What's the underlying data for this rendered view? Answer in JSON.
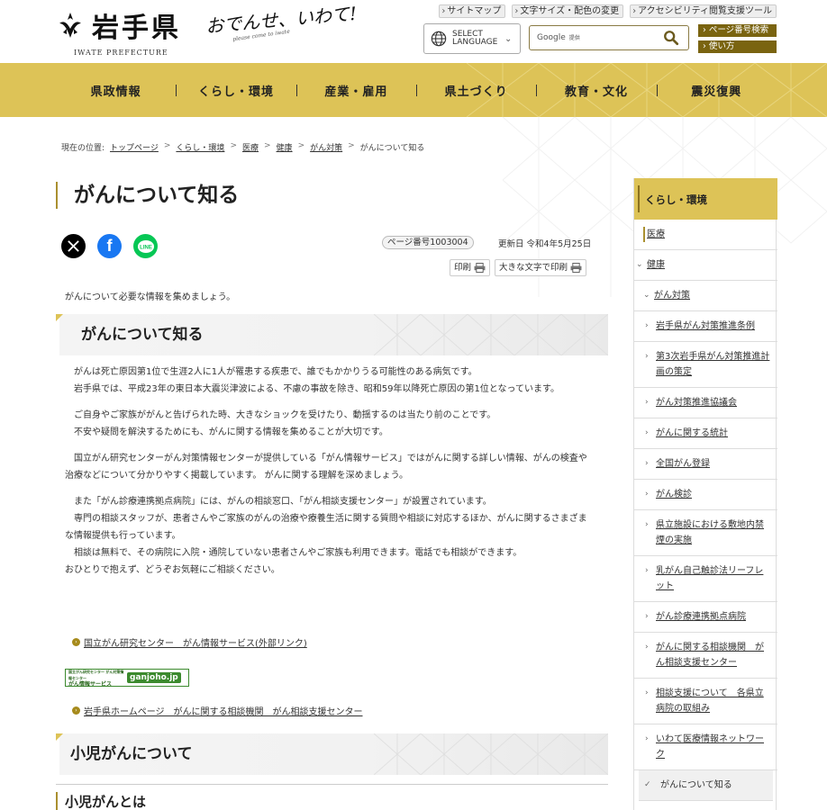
{
  "header": {
    "logo_title": "岩手県",
    "logo_sub": "IWATE PREFECTURE",
    "tagline": "おでんせ、いわて!",
    "tagline_sub": "please come to iwate",
    "util_links": [
      "サイトマップ",
      "文字サイズ・配色の変更",
      "アクセシビリティ閲覧支援ツール"
    ],
    "language_label_1": "SELECT",
    "language_label_2": "LANGUAGE",
    "search_brand": "Google",
    "search_brand_sub": "提供",
    "page_number_search": "ページ番号検索",
    "howto": "使い方"
  },
  "nav": {
    "items": [
      "県政情報",
      "くらし・環境",
      "産業・雇用",
      "県土づくり",
      "教育・文化",
      "震災復興"
    ]
  },
  "breadcrumb": {
    "label": "現在の位置:",
    "items": [
      "トップページ",
      "くらし・環境",
      "医療",
      "健康",
      "がん対策"
    ],
    "current": "がんについて知る"
  },
  "main": {
    "title": "がんについて知る",
    "page_number": "ページ番号1003004",
    "updated": "更新日 令和4年5月25日",
    "print_label": "印刷",
    "print_large_label": "大きな文字で印刷",
    "lead": "がんについて必要な情報を集めましょう。",
    "section1_title": "がんについて知る",
    "paragraphs": [
      "　がんは死亡原因第1位で生涯2人に1人が罹患する疾患で、誰でもかかりうる可能性のある病気です。\n　岩手県では、平成23年の東日本大震災津波による、不慮の事故を除き、昭和59年以降死亡原因の第1位となっています。",
      "　ご自身やご家族ががんと告げられた時、大きなショックを受けたり、動揺するのは当たり前のことです。\n　不安や疑問を解決するためにも、がんに関する情報を集めることが大切です。",
      "　国立がん研究センターがん対策情報センターが提供している「がん情報サービス」ではがんに関する詳しい情報、がんの検査や治療などについて分かりやすく掲載しています。 がんに関する理解を深めましょう。",
      "　また「がん診療連携拠点病院」には、がんの相談窓口、「がん相談支援センター」が設置されています。\n　専門の相談スタッフが、患者さんやご家族のがんの治療や療養生活に関する質問や相談に対応するほか、がんに関するさまざまな情報提供も行っています。\n　相談は無料で、その病院に入院・通院していない患者さんやご家族も利用できます。電話でも相談ができます。\nおひとりで抱えず、どうぞお気軽にご相談ください。"
    ],
    "link1": "国立がん研究センター　がん情報サービス(外部リンク)",
    "banner_left_1": "国立がん研究センター がん対策情報センター",
    "banner_left_2": "がん情報サービス",
    "banner_right": "ganjoho.jp",
    "link2": "岩手県ホームページ　がんに関する相談機関　がん相談支援センター",
    "section2_title": "小児がんについて",
    "subsection_title": "小児がんとは"
  },
  "sidebar": {
    "head": "くらし・環境",
    "lv1": "医療",
    "lv2": "健康",
    "lv3": "がん対策",
    "items": [
      "岩手県がん対策推進条例",
      "第3次岩手県がん対策推進計画の策定",
      "がん対策推進協議会",
      "がんに関する統計",
      "全国がん登録",
      "がん検診",
      "県立施設における敷地内禁煙の実施",
      "乳がん自己触診法リーフレット",
      "がん診療連携拠点病院",
      "がんに関する相談機関　がん相談支援センター",
      "相談支援について　各県立病院の取組み",
      "いわて医療情報ネットワーク"
    ],
    "current": "がんについて知る"
  },
  "colors": {
    "gold": "#ddc357",
    "dark_gold": "#7a6410"
  }
}
